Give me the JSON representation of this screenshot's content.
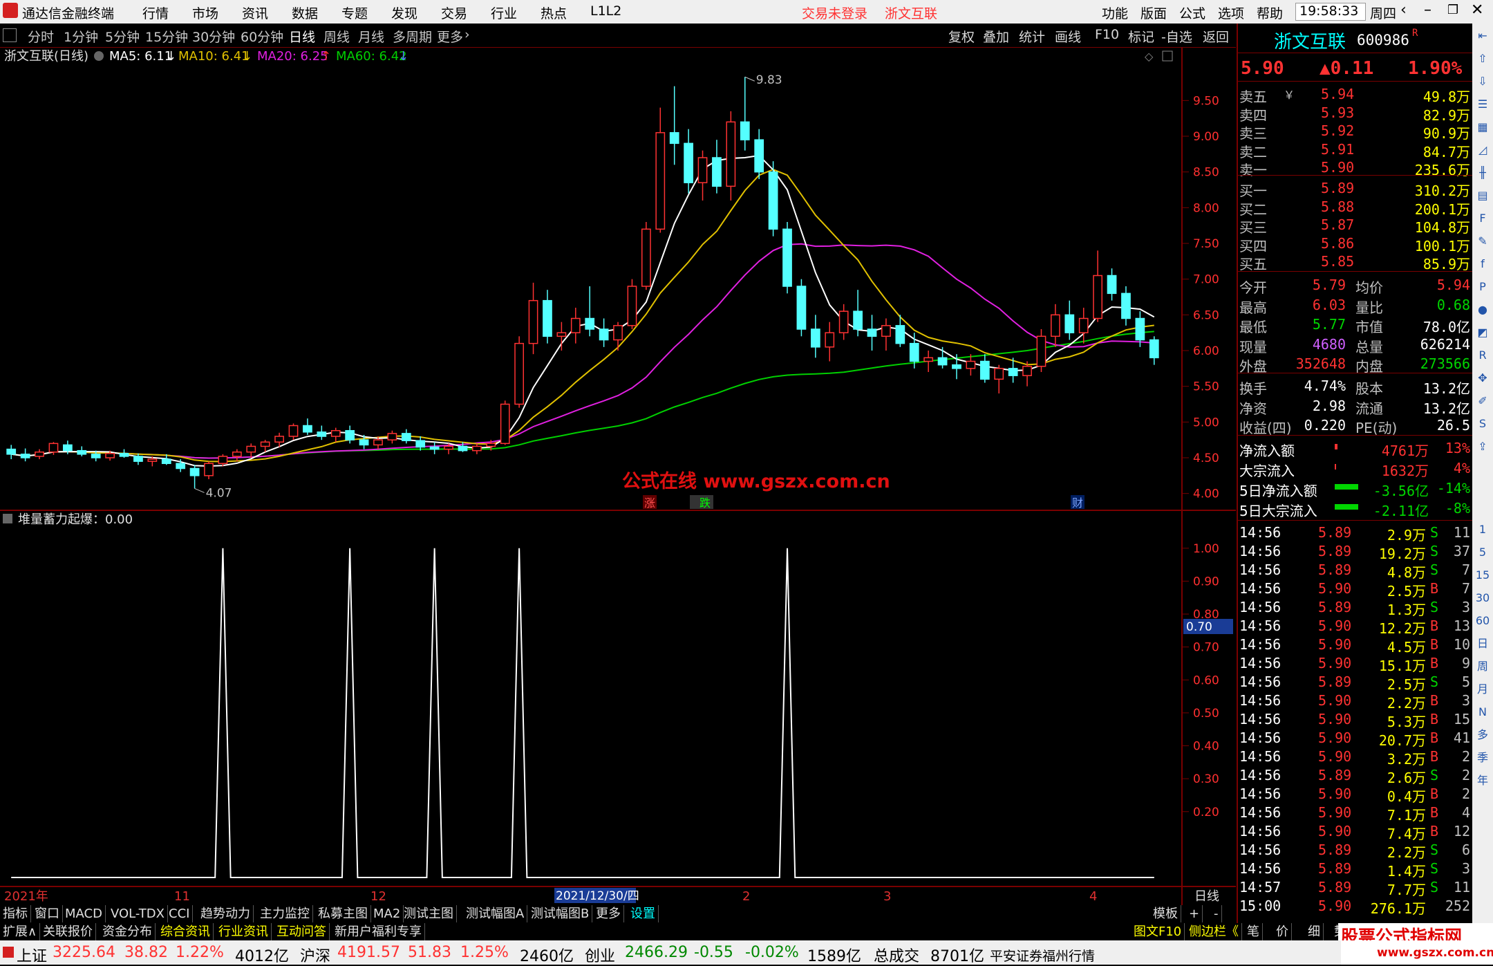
{
  "titlebar": {
    "app_name": "通达信金融终端",
    "menus": [
      "行情",
      "市场",
      "资讯",
      "数据",
      "专题",
      "发现",
      "交易",
      "行业",
      "热点",
      "L1L2"
    ],
    "login_status": "交易未登录",
    "stock_title": "浙文互联",
    "right_menus": [
      "功能",
      "版面",
      "公式",
      "选项",
      "帮助"
    ],
    "time": "19:58:33",
    "weekday": "周四"
  },
  "periods": [
    "分时",
    "1分钟",
    "5分钟",
    "15分钟",
    "30分钟",
    "60分钟",
    "日线",
    "周线",
    "月线",
    "多周期",
    "更多"
  ],
  "active_period": "日线",
  "tools": [
    "复权",
    "叠加",
    "统计",
    "画线",
    "F10",
    "标记",
    "-自选",
    "返回"
  ],
  "main_chart": {
    "legend_name": "浙文互联(日线)",
    "ma5": "MA5: 6.11",
    "ma10": "MA10: 6.41",
    "ma20": "MA20: 6.25",
    "ma60": "MA60: 6.42",
    "high_label": "9.83",
    "low_label": "4.07",
    "watermark": "公式在线  www.gszx.com.cn",
    "markers": [
      "涨",
      "跌",
      "财"
    ],
    "y_ticks": [
      "9.50",
      "9.00",
      "8.50",
      "8.00",
      "7.50",
      "7.00",
      "6.50",
      "6.00",
      "5.50",
      "5.00",
      "4.50",
      "4.00"
    ]
  },
  "sub_chart": {
    "legend": "堆量蓄力起爆：0.00",
    "y_ticks": [
      "1.00",
      "0.90",
      "0.80",
      "0.70",
      "0.60",
      "0.50",
      "0.40",
      "0.30",
      "0.20"
    ],
    "cursor_value": "0.70"
  },
  "x_axis": {
    "labels": [
      "2021年",
      "11",
      "12",
      "2021/12/30/四",
      "2",
      "3",
      "4"
    ],
    "period_label": "日线"
  },
  "chart_data": {
    "type": "candlestick",
    "title": "浙文互联(日线)",
    "ylim": [
      3.9,
      9.9
    ],
    "high": 9.83,
    "low": 4.07,
    "ma_latest": {
      "MA5": 6.11,
      "MA10": 6.41,
      "MA20": 6.25,
      "MA60": 6.42
    },
    "candles_ohlc_sample": [
      [
        4.62,
        4.68,
        4.48,
        4.55
      ],
      [
        4.55,
        4.63,
        4.45,
        4.5
      ],
      [
        4.52,
        4.62,
        4.48,
        4.58
      ],
      [
        4.58,
        4.72,
        4.54,
        4.7
      ],
      [
        4.68,
        4.74,
        4.55,
        4.6
      ],
      [
        4.6,
        4.66,
        4.52,
        4.55
      ],
      [
        4.55,
        4.6,
        4.45,
        4.5
      ],
      [
        4.5,
        4.6,
        4.46,
        4.56
      ],
      [
        4.56,
        4.62,
        4.5,
        4.52
      ],
      [
        4.52,
        4.56,
        4.4,
        4.45
      ],
      [
        4.45,
        4.52,
        4.38,
        4.48
      ],
      [
        4.48,
        4.55,
        4.4,
        4.42
      ],
      [
        4.42,
        4.48,
        4.3,
        4.35
      ],
      [
        4.35,
        4.4,
        4.07,
        4.25
      ],
      [
        4.25,
        4.45,
        4.2,
        4.42
      ],
      [
        4.42,
        4.55,
        4.38,
        4.52
      ],
      [
        4.52,
        4.62,
        4.45,
        4.58
      ],
      [
        4.58,
        4.7,
        4.5,
        4.66
      ],
      [
        4.66,
        4.75,
        4.58,
        4.72
      ],
      [
        4.72,
        4.85,
        4.65,
        4.8
      ],
      [
        4.8,
        4.98,
        4.75,
        4.95
      ],
      [
        4.95,
        5.05,
        4.82,
        4.86
      ],
      [
        4.86,
        4.95,
        4.75,
        4.8
      ],
      [
        4.8,
        4.92,
        4.72,
        4.88
      ],
      [
        4.88,
        4.95,
        4.7,
        4.75
      ],
      [
        4.75,
        4.82,
        4.62,
        4.68
      ],
      [
        4.68,
        4.8,
        4.62,
        4.75
      ],
      [
        4.75,
        4.88,
        4.7,
        4.84
      ],
      [
        4.84,
        4.9,
        4.7,
        4.74
      ],
      [
        4.74,
        4.8,
        4.6,
        4.65
      ],
      [
        4.65,
        4.72,
        4.55,
        4.62
      ],
      [
        4.62,
        4.7,
        4.55,
        4.66
      ],
      [
        4.66,
        4.72,
        4.58,
        4.6
      ],
      [
        4.6,
        4.7,
        4.55,
        4.66
      ],
      [
        4.66,
        4.75,
        4.6,
        4.7
      ],
      [
        4.7,
        5.3,
        4.68,
        5.25
      ],
      [
        5.25,
        6.2,
        5.2,
        6.1
      ],
      [
        6.1,
        6.95,
        5.95,
        6.7
      ],
      [
        6.7,
        6.85,
        6.1,
        6.2
      ],
      [
        6.2,
        6.4,
        6.0,
        6.25
      ],
      [
        6.25,
        6.6,
        6.1,
        6.45
      ],
      [
        6.45,
        6.9,
        6.2,
        6.3
      ],
      [
        6.3,
        6.45,
        6.05,
        6.15
      ],
      [
        6.15,
        6.4,
        6.0,
        6.35
      ],
      [
        6.35,
        7.0,
        6.3,
        6.9
      ],
      [
        6.9,
        7.8,
        6.85,
        7.7
      ],
      [
        7.7,
        9.4,
        7.65,
        9.05
      ],
      [
        9.05,
        9.7,
        8.6,
        8.9
      ],
      [
        8.9,
        9.1,
        8.2,
        8.35
      ],
      [
        8.35,
        8.8,
        8.1,
        8.7
      ],
      [
        8.7,
        8.95,
        8.2,
        8.3
      ],
      [
        8.3,
        9.35,
        8.1,
        9.2
      ],
      [
        9.2,
        9.83,
        8.8,
        8.95
      ],
      [
        8.95,
        9.1,
        8.4,
        8.5
      ],
      [
        8.5,
        8.65,
        7.6,
        7.7
      ],
      [
        7.7,
        7.8,
        6.8,
        6.9
      ],
      [
        6.9,
        7.0,
        6.2,
        6.3
      ],
      [
        6.3,
        6.5,
        5.9,
        6.05
      ],
      [
        6.05,
        6.4,
        5.85,
        6.25
      ],
      [
        6.25,
        6.65,
        6.15,
        6.55
      ],
      [
        6.55,
        6.85,
        6.2,
        6.3
      ],
      [
        6.3,
        6.5,
        6.0,
        6.2
      ],
      [
        6.2,
        6.45,
        6.0,
        6.35
      ],
      [
        6.35,
        6.5,
        6.05,
        6.1
      ],
      [
        6.1,
        6.25,
        5.75,
        5.85
      ],
      [
        5.85,
        6.0,
        5.7,
        5.9
      ],
      [
        5.9,
        6.05,
        5.75,
        5.8
      ],
      [
        5.8,
        5.95,
        5.6,
        5.75
      ],
      [
        5.75,
        5.95,
        5.65,
        5.85
      ],
      [
        5.85,
        5.95,
        5.55,
        5.6
      ],
      [
        5.6,
        5.8,
        5.4,
        5.75
      ],
      [
        5.75,
        5.9,
        5.55,
        5.65
      ],
      [
        5.65,
        5.85,
        5.5,
        5.78
      ],
      [
        5.78,
        6.3,
        5.7,
        6.2
      ],
      [
        6.2,
        6.65,
        6.05,
        6.5
      ],
      [
        6.5,
        6.7,
        6.15,
        6.25
      ],
      [
        6.25,
        6.6,
        6.1,
        6.45
      ],
      [
        6.45,
        7.4,
        6.4,
        7.05
      ],
      [
        7.05,
        7.15,
        6.7,
        6.8
      ],
      [
        6.8,
        6.9,
        6.35,
        6.45
      ],
      [
        6.45,
        6.55,
        6.05,
        6.15
      ],
      [
        6.15,
        6.2,
        5.8,
        5.9
      ]
    ],
    "sub_series": {
      "name": "堆量蓄力起爆",
      "peaks_at_index": [
        15,
        24,
        30,
        36,
        55
      ],
      "peak_value": 1.0,
      "base_value": 0.0
    }
  },
  "quote": {
    "name": "浙文互联",
    "code": "600986",
    "flag": "R",
    "price": "5.90",
    "change": "▲0.11",
    "pct": "1.90%",
    "asks": [
      {
        "label": "卖五",
        "sym": "￥",
        "price": "5.94",
        "vol": "49.8万"
      },
      {
        "label": "卖四",
        "sym": "",
        "price": "5.93",
        "vol": "82.9万"
      },
      {
        "label": "卖三",
        "sym": "",
        "price": "5.92",
        "vol": "90.9万"
      },
      {
        "label": "卖二",
        "sym": "",
        "price": "5.91",
        "vol": "84.7万"
      },
      {
        "label": "卖一",
        "sym": "",
        "price": "5.90",
        "vol": "235.6万"
      }
    ],
    "bids": [
      {
        "label": "买一",
        "price": "5.89",
        "vol": "310.2万"
      },
      {
        "label": "买二",
        "price": "5.88",
        "vol": "200.1万"
      },
      {
        "label": "买三",
        "price": "5.87",
        "vol": "104.8万"
      },
      {
        "label": "买四",
        "price": "5.86",
        "vol": "100.1万"
      },
      {
        "label": "买五",
        "price": "5.85",
        "vol": "85.9万"
      }
    ],
    "stats": [
      {
        "l1": "今开",
        "v1": "5.79",
        "c1": "red",
        "l2": "均价",
        "v2": "5.94",
        "c2": "red"
      },
      {
        "l1": "最高",
        "v1": "6.03",
        "c1": "red",
        "l2": "量比",
        "v2": "0.68",
        "c2": "green"
      },
      {
        "l1": "最低",
        "v1": "5.77",
        "c1": "green",
        "l2": "市值",
        "v2": "78.0亿",
        "c2": "white"
      },
      {
        "l1": "现量",
        "v1": "4680",
        "c1": "purple",
        "l2": "总量",
        "v2": "626214",
        "c2": "white"
      },
      {
        "l1": "外盘",
        "v1": "352648",
        "c1": "red",
        "l2": "内盘",
        "v2": "273566",
        "c2": "green"
      }
    ],
    "stats2": [
      {
        "l1": "换手",
        "v1": "4.74%",
        "l2": "股本",
        "v2": "13.2亿"
      },
      {
        "l1": "净资",
        "v1": "2.98",
        "l2": "流通",
        "v2": "13.2亿"
      },
      {
        "l1": "收益(四)",
        "v1": "0.220",
        "l2": "PE(动)",
        "v2": "26.5"
      }
    ],
    "flows": [
      {
        "label": "净流入额",
        "value": "4761万",
        "pct": "13%",
        "color": "red",
        "bar": "small-red"
      },
      {
        "label": "大宗流入",
        "value": "1632万",
        "pct": "4%",
        "color": "red",
        "bar": "tiny-red"
      },
      {
        "label": "5日净流入额",
        "value": "-3.56亿",
        "pct": "-14%",
        "color": "green",
        "bar": "green"
      },
      {
        "label": "5日大宗流入",
        "value": "-2.11亿",
        "pct": "-8%",
        "color": "green",
        "bar": "green"
      }
    ],
    "ticks": [
      {
        "t": "14:56",
        "p": "5.89",
        "v": "2.9万",
        "s": "S",
        "n": "11"
      },
      {
        "t": "14:56",
        "p": "5.89",
        "v": "19.2万",
        "s": "S",
        "n": "37"
      },
      {
        "t": "14:56",
        "p": "5.89",
        "v": "4.8万",
        "s": "S",
        "n": "7"
      },
      {
        "t": "14:56",
        "p": "5.90",
        "v": "2.5万",
        "s": "B",
        "n": "7"
      },
      {
        "t": "14:56",
        "p": "5.89",
        "v": "1.3万",
        "s": "S",
        "n": "3"
      },
      {
        "t": "14:56",
        "p": "5.90",
        "v": "12.2万",
        "s": "B",
        "n": "13"
      },
      {
        "t": "14:56",
        "p": "5.90",
        "v": "4.5万",
        "s": "B",
        "n": "10"
      },
      {
        "t": "14:56",
        "p": "5.90",
        "v": "15.1万",
        "s": "B",
        "n": "9"
      },
      {
        "t": "14:56",
        "p": "5.89",
        "v": "2.5万",
        "s": "S",
        "n": "5"
      },
      {
        "t": "14:56",
        "p": "5.90",
        "v": "2.2万",
        "s": "B",
        "n": "3"
      },
      {
        "t": "14:56",
        "p": "5.90",
        "v": "5.3万",
        "s": "B",
        "n": "15"
      },
      {
        "t": "14:56",
        "p": "5.90",
        "v": "20.7万",
        "s": "B",
        "n": "41"
      },
      {
        "t": "14:56",
        "p": "5.90",
        "v": "3.2万",
        "s": "B",
        "n": "2"
      },
      {
        "t": "14:56",
        "p": "5.89",
        "v": "2.6万",
        "s": "S",
        "n": "2"
      },
      {
        "t": "14:56",
        "p": "5.90",
        "v": "0.4万",
        "s": "B",
        "n": "2"
      },
      {
        "t": "14:56",
        "p": "5.90",
        "v": "7.1万",
        "s": "B",
        "n": "4"
      },
      {
        "t": "14:56",
        "p": "5.90",
        "v": "7.4万",
        "s": "B",
        "n": "12"
      },
      {
        "t": "14:56",
        "p": "5.89",
        "v": "2.2万",
        "s": "S",
        "n": "6"
      },
      {
        "t": "14:56",
        "p": "5.89",
        "v": "1.4万",
        "s": "S",
        "n": "3"
      },
      {
        "t": "14:57",
        "p": "5.89",
        "v": "7.7万",
        "s": "S",
        "n": "11"
      },
      {
        "t": "15:00",
        "p": "5.90",
        "v": "276.1万",
        "s": "",
        "n": "252"
      }
    ]
  },
  "side_icons": [
    "collapse-icon",
    "up-icon",
    "down-icon",
    "list-icon",
    "grid-icon",
    "chart-icon",
    "candle-icon",
    "table-icon",
    "f10-icon",
    "note-icon",
    "f-icon",
    "p-icon",
    "dot-icon",
    "chart2-icon",
    "rsi-icon",
    "move-icon",
    "pen-icon",
    "fs-icon",
    "share-icon"
  ],
  "side_periods": [
    "1",
    "5",
    "15",
    "30",
    "60",
    "日",
    "周",
    "月",
    "N",
    "多",
    "季",
    "年"
  ],
  "tabs1": [
    "指标",
    "窗口",
    "MACD",
    "VOL-TDX",
    "CCI",
    "趋势动力",
    "主力监控",
    "私募主图",
    "MA2",
    "测试主图",
    "测试幅图A",
    "测试幅图B",
    "更多",
    "设置"
  ],
  "tabs1_right": [
    "模板",
    "+",
    "-"
  ],
  "tabs2": [
    "扩展∧",
    "关联报价",
    "资金分布",
    "综合资讯",
    "行业资讯",
    "互动问答",
    "新用户福利专享"
  ],
  "tabs2_right": [
    "图文F10",
    "侧边栏《",
    "笔",
    "价",
    "细",
    "势"
  ],
  "brand": "股票公式指标网",
  "brand_url": "www.gszx.com.cn",
  "status": {
    "sh_label": "上证",
    "sh_val": "3225.64",
    "sh_chg": "38.82",
    "sh_pct": "1.22%",
    "sh_amt": "4012亿",
    "hs_label": "沪深",
    "hs_val": "4191.57",
    "hs_chg": "51.83",
    "hs_pct": "1.25%",
    "hs_amt": "2460亿",
    "cy_label": "创业",
    "cy_val": "2466.29",
    "cy_chg": "-0.55",
    "cy_pct": "-0.02%",
    "cy_amt": "1589亿",
    "total_label": "总成交",
    "total_val": "8701亿",
    "broker": "平安证券福州行情"
  }
}
